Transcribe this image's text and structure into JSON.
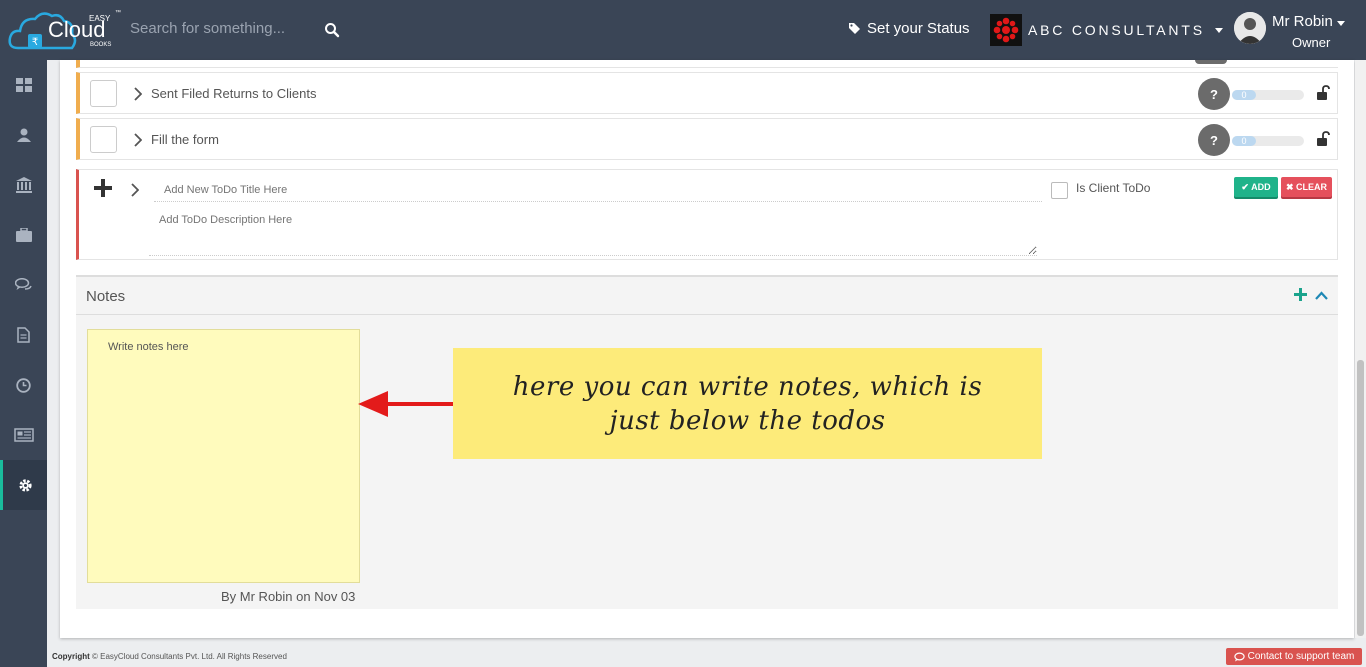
{
  "header": {
    "logo": {
      "brand_small": "EASY",
      "brand": "Cloud",
      "brand_sub": "BOOKS",
      "tm": "™"
    },
    "search_placeholder": "Search for something...",
    "status_label": "Set your Status",
    "company_name": "ABC CONSULTANTS",
    "user_name": "Mr Robin",
    "user_role": "Owner"
  },
  "sidebar": {
    "items": [
      {
        "icon": "dashboard-icon"
      },
      {
        "icon": "user-icon"
      },
      {
        "icon": "bank-icon"
      },
      {
        "icon": "briefcase-icon"
      },
      {
        "icon": "chat-icon"
      },
      {
        "icon": "document-icon"
      },
      {
        "icon": "clock-icon"
      },
      {
        "icon": "newspaper-icon"
      },
      {
        "icon": "gear-icon",
        "active": true
      }
    ]
  },
  "todos": [
    {
      "title": "Sent Filed Returns to Clients",
      "help": "?",
      "progress_value": "0",
      "progress_pct": 0
    },
    {
      "title": "Fill the form",
      "help": "?",
      "progress_value": "0",
      "progress_pct": 0
    }
  ],
  "new_todo": {
    "title_placeholder": "Add New ToDo Title Here",
    "desc_placeholder": "Add ToDo Description Here",
    "client_label": "Is Client ToDo",
    "add_label": "ADD",
    "clear_label": "CLEAR"
  },
  "notes": {
    "title": "Notes",
    "note_placeholder": "Write notes here",
    "note_by": "By Mr Robin on Nov 03"
  },
  "callout": {
    "text": "here you can write notes, which is just below the todos"
  },
  "footer": {
    "copyright_label": "Copyright",
    "copyright_text": "© EasyCloud Consultants Pvt. Ltd. All Rights Reserved",
    "support_label": "Contact to support team"
  },
  "colors": {
    "topbar": "#3a4556",
    "accent_green": "#1abc9c",
    "todo_border": "#f0ad4e",
    "new_todo_border": "#d9534f",
    "note_bg": "#fffbbd",
    "callout_bg": "#fdeb7a"
  }
}
